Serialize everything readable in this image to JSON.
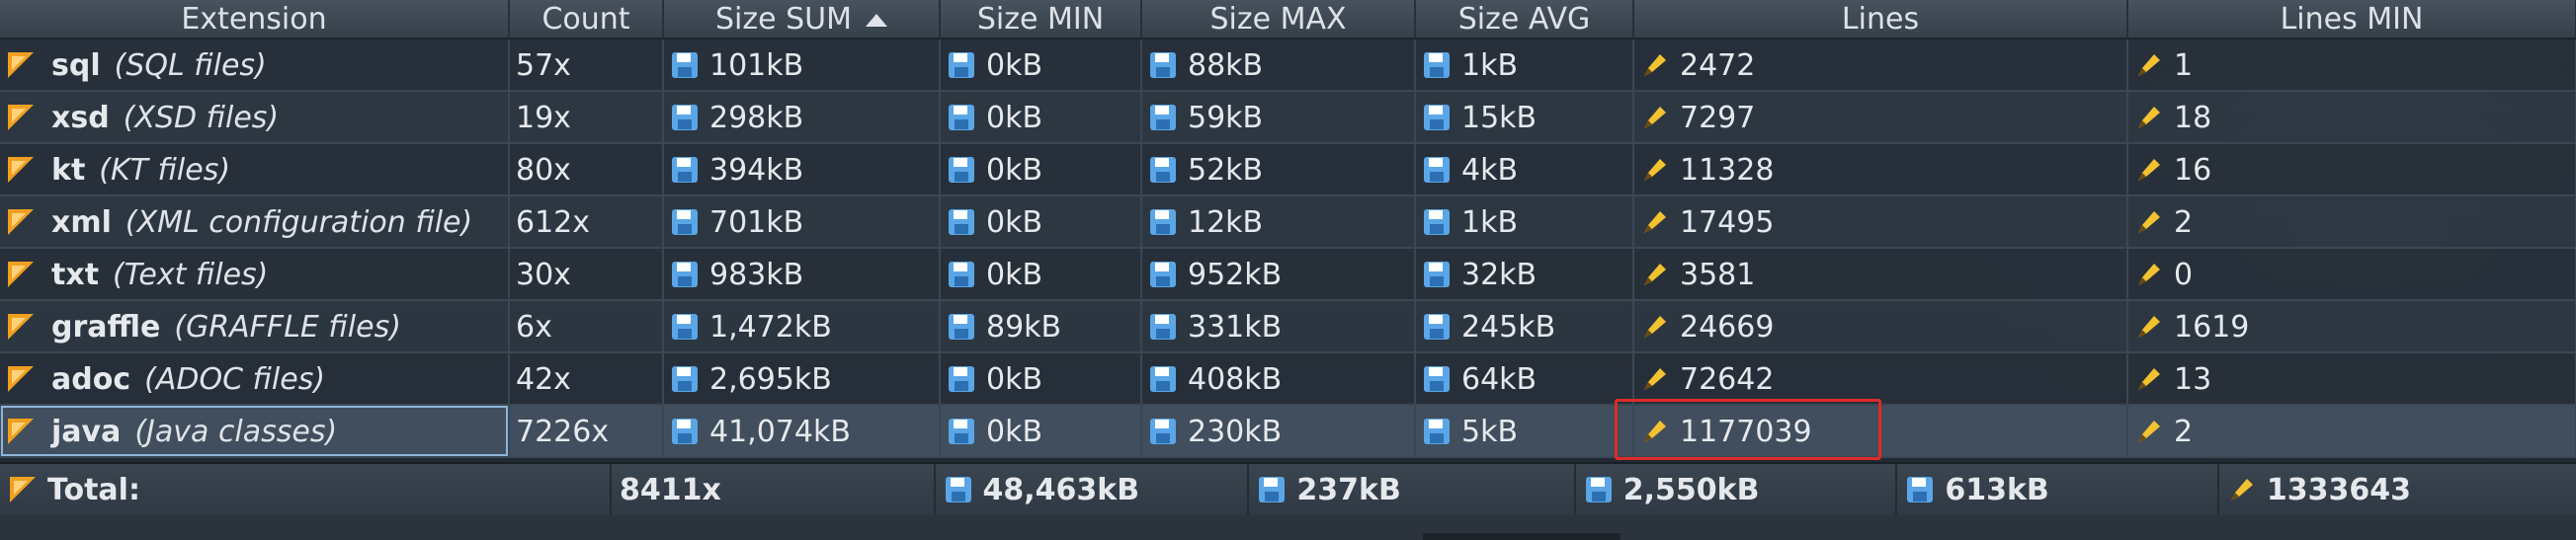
{
  "columns": [
    "Extension",
    "Count",
    "Size SUM",
    "Size MIN",
    "Size MAX",
    "Size AVG",
    "Lines",
    "Lines MIN"
  ],
  "sort_column": "Size SUM",
  "rows": [
    {
      "ext": "sql",
      "desc": "(SQL files)",
      "count": "57x",
      "size_sum": "101kB",
      "size_min": "0kB",
      "size_max": "88kB",
      "size_avg": "1kB",
      "lines": "2472",
      "lines_min": "1"
    },
    {
      "ext": "xsd",
      "desc": "(XSD files)",
      "count": "19x",
      "size_sum": "298kB",
      "size_min": "0kB",
      "size_max": "59kB",
      "size_avg": "15kB",
      "lines": "7297",
      "lines_min": "18"
    },
    {
      "ext": "kt",
      "desc": "(KT files)",
      "count": "80x",
      "size_sum": "394kB",
      "size_min": "0kB",
      "size_max": "52kB",
      "size_avg": "4kB",
      "lines": "11328",
      "lines_min": "16"
    },
    {
      "ext": "xml",
      "desc": "(XML configuration file)",
      "count": "612x",
      "size_sum": "701kB",
      "size_min": "0kB",
      "size_max": "12kB",
      "size_avg": "1kB",
      "lines": "17495",
      "lines_min": "2"
    },
    {
      "ext": "txt",
      "desc": "(Text files)",
      "count": "30x",
      "size_sum": "983kB",
      "size_min": "0kB",
      "size_max": "952kB",
      "size_avg": "32kB",
      "lines": "3581",
      "lines_min": "0"
    },
    {
      "ext": "graffle",
      "desc": "(GRAFFLE files)",
      "count": "6x",
      "size_sum": "1,472kB",
      "size_min": "89kB",
      "size_max": "331kB",
      "size_avg": "245kB",
      "lines": "24669",
      "lines_min": "1619"
    },
    {
      "ext": "adoc",
      "desc": "(ADOC files)",
      "count": "42x",
      "size_sum": "2,695kB",
      "size_min": "0kB",
      "size_max": "408kB",
      "size_avg": "64kB",
      "lines": "72642",
      "lines_min": "13"
    },
    {
      "ext": "java",
      "desc": "(Java classes)",
      "count": "7226x",
      "size_sum": "41,074kB",
      "size_min": "0kB",
      "size_max": "230kB",
      "size_avg": "5kB",
      "lines": "1177039",
      "lines_min": "2"
    }
  ],
  "total": {
    "label": "Total:",
    "count": "8411x",
    "size_sum": "48,463kB",
    "size_max": "237kB",
    "size_avg": "2,550kB",
    "size_other": "613kB",
    "lines": "1333643"
  },
  "colors": {
    "highlight": "#e02a2a",
    "folder_icon": "#f0a020",
    "disk_icon": "#5aa6e6",
    "pencil_icon": "#f3c230"
  },
  "icons": {
    "row": "folder-arrow-icon",
    "size": "floppy-disk-icon",
    "lines": "pencil-icon"
  }
}
